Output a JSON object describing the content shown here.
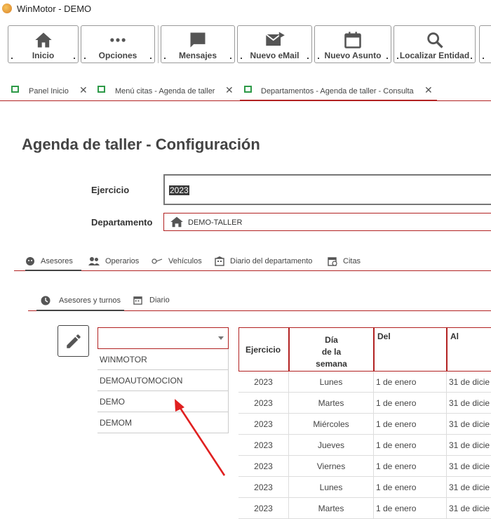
{
  "window": {
    "title": "WinMotor - DEMO"
  },
  "toolbar": {
    "buttons": [
      {
        "label": "Inicio",
        "icon": "home-icon"
      },
      {
        "label": "Opciones",
        "icon": "more-icon"
      },
      {
        "label": "Mensajes",
        "icon": "message-icon"
      },
      {
        "label": "Nuevo eMail",
        "icon": "email-icon"
      },
      {
        "label": "Nuevo Asunto",
        "icon": "calendar-icon"
      },
      {
        "label": "Localizar Entidad",
        "icon": "search-icon"
      }
    ]
  },
  "doc_tabs": [
    {
      "label": "Panel Inicio"
    },
    {
      "label": "Menú citas - Agenda de taller"
    },
    {
      "label": "Departamentos - Agenda de taller - Consulta"
    }
  ],
  "page": {
    "title": "Agenda de taller - Configuración",
    "ejercicio_label": "Ejercicio",
    "ejercicio_value": "2023",
    "departamento_label": "Departamento",
    "departamento_value": "DEMO-TALLER"
  },
  "sub_tabs": [
    {
      "label": "Asesores"
    },
    {
      "label": "Operarios"
    },
    {
      "label": "Vehículos"
    },
    {
      "label": "Diario del departamento"
    },
    {
      "label": "Citas"
    }
  ],
  "inner_tabs": [
    {
      "label": "Asesores y turnos"
    },
    {
      "label": "Diario"
    }
  ],
  "combo": {
    "options": [
      "WINMOTOR",
      "DEMOAUTOMOCION",
      "DEMO",
      "DEMOM"
    ]
  },
  "table": {
    "headers": [
      "Ejercicio",
      "Día\nde la\nsemana",
      "Del",
      "Al"
    ],
    "rows": [
      [
        "2023",
        "Lunes",
        "1 de enero",
        "31 de dicie"
      ],
      [
        "2023",
        "Martes",
        "1 de enero",
        "31 de dicie"
      ],
      [
        "2023",
        "Miércoles",
        "1 de enero",
        "31 de dicie"
      ],
      [
        "2023",
        "Jueves",
        "1 de enero",
        "31 de dicie"
      ],
      [
        "2023",
        "Viernes",
        "1 de enero",
        "31 de dicie"
      ],
      [
        "2023",
        "Lunes",
        "1 de enero",
        "31 de dicie"
      ],
      [
        "2023",
        "Martes",
        "1 de enero",
        "31 de dicie"
      ]
    ]
  },
  "colors": {
    "accent": "#b22222",
    "tab_icon": "#2e9a48",
    "arrow": "#e02020"
  }
}
